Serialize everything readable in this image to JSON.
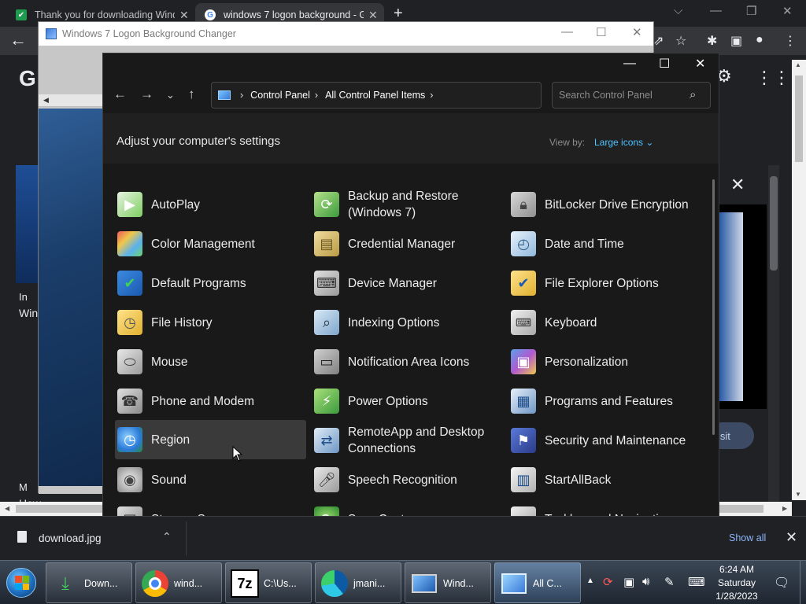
{
  "browser": {
    "tabs": [
      {
        "title": "Thank you for downloading Wind",
        "favicon": "download-site-icon"
      },
      {
        "title": "windows 7 logon background - G",
        "favicon": "google-icon"
      }
    ],
    "new_tab": "+",
    "back": "←",
    "page_letter": "G",
    "left_text_1": "In",
    "left_text_2": "Win",
    "left_text_3": "M",
    "left_text_4": "How",
    "visit_button": "isit"
  },
  "logon_changer": {
    "title": "Windows 7 Logon Background Changer"
  },
  "control_panel": {
    "breadcrumbs": [
      "Control Panel",
      "All Control Panel Items"
    ],
    "search_placeholder": "Search Control Panel",
    "heading": "Adjust your computer's settings",
    "view_by_label": "View by:",
    "view_by_value": "Large icons",
    "items": [
      {
        "label": "AutoPlay",
        "icon": "autoplay-icon"
      },
      {
        "label": "Backup and Restore (Windows 7)",
        "icon": "backup-restore-icon"
      },
      {
        "label": "BitLocker Drive Encryption",
        "icon": "bitlocker-icon"
      },
      {
        "label": "Color Management",
        "icon": "color-management-icon"
      },
      {
        "label": "Credential Manager",
        "icon": "credential-manager-icon"
      },
      {
        "label": "Date and Time",
        "icon": "date-time-icon"
      },
      {
        "label": "Default Programs",
        "icon": "default-programs-icon"
      },
      {
        "label": "Device Manager",
        "icon": "device-manager-icon"
      },
      {
        "label": "File Explorer Options",
        "icon": "file-explorer-options-icon"
      },
      {
        "label": "File History",
        "icon": "file-history-icon"
      },
      {
        "label": "Indexing Options",
        "icon": "indexing-options-icon"
      },
      {
        "label": "Keyboard",
        "icon": "keyboard-icon"
      },
      {
        "label": "Mouse",
        "icon": "mouse-icon"
      },
      {
        "label": "Notification Area Icons",
        "icon": "notification-area-icon"
      },
      {
        "label": "Personalization",
        "icon": "personalization-icon"
      },
      {
        "label": "Phone and Modem",
        "icon": "phone-modem-icon"
      },
      {
        "label": "Power Options",
        "icon": "power-options-icon"
      },
      {
        "label": "Programs and Features",
        "icon": "programs-features-icon"
      },
      {
        "label": "Region",
        "icon": "region-icon"
      },
      {
        "label": "RemoteApp and Desktop Connections",
        "icon": "remoteapp-icon"
      },
      {
        "label": "Security and Maintenance",
        "icon": "security-maintenance-icon"
      },
      {
        "label": "Sound",
        "icon": "sound-icon"
      },
      {
        "label": "Speech Recognition",
        "icon": "speech-recognition-icon"
      },
      {
        "label": "StartAllBack",
        "icon": "startallback-icon"
      },
      {
        "label": "Storage Spaces",
        "icon": "storage-spaces-icon"
      },
      {
        "label": "Sync Center",
        "icon": "sync-center-icon"
      },
      {
        "label": "Taskbar and Navigation",
        "icon": "taskbar-navigation-icon"
      }
    ],
    "hovered_item": "Region"
  },
  "download_bar": {
    "filename": "download.jpg",
    "show_all": "Show all"
  },
  "taskbar": {
    "buttons": [
      {
        "label": "Down...",
        "icon": "download-arrow-icon"
      },
      {
        "label": "wind...",
        "icon": "chrome-icon"
      },
      {
        "label": "C:\\Us...",
        "icon": "7zip-icon"
      },
      {
        "label": "jmani...",
        "icon": "edge-icon"
      },
      {
        "label": "Wind...",
        "icon": "monitor-icon"
      },
      {
        "label": "All C...",
        "icon": "control-panel-icon"
      }
    ],
    "clock": {
      "time": "6:24 AM",
      "day": "Saturday",
      "date": "1/28/2023"
    }
  },
  "colors": {
    "accent_link": "#4cc2ff",
    "chrome_link": "#8ab4f8",
    "cp_background": "#191919"
  }
}
